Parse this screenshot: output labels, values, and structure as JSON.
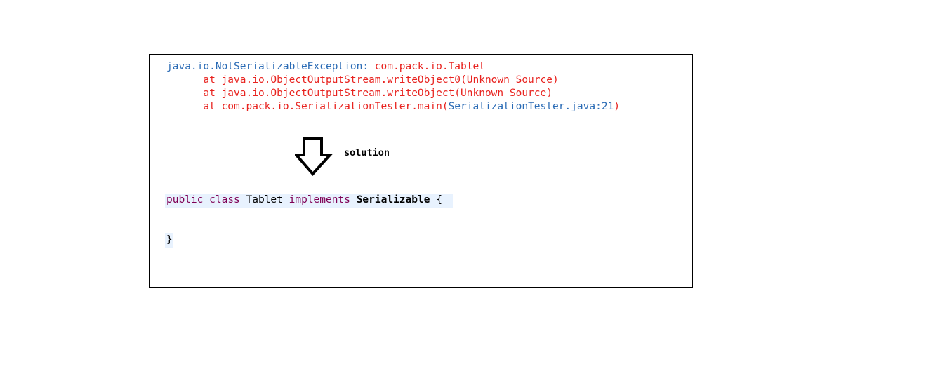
{
  "exception": {
    "class_name": "java.io.NotSerializableException",
    "colon": ":",
    "message": " com.pack.io.Tablet"
  },
  "stack_trace": [
    {
      "text": "      at java.io.ObjectOutputStream.writeObject0(Unknown Source)"
    },
    {
      "text": "      at java.io.ObjectOutputStream.writeObject(Unknown Source)"
    },
    {
      "prefix": "      at com.pack.io.SerializationTester.main(",
      "link": "SerializationTester.java:21",
      "suffix": ")"
    }
  ],
  "arrow": {
    "icon": "down-arrow-icon"
  },
  "solution_label": "solution",
  "code": {
    "kw_public": "public",
    "kw_class": "class",
    "class_name": "Tablet",
    "kw_implements": "implements",
    "interface": "Serializable",
    "open_brace": "{",
    "close_brace": "}"
  },
  "colors": {
    "link_blue": "#2a6bb5",
    "error_red": "#e8231f",
    "keyword_purple": "#7f0055",
    "line_highlight": "#e8f2fe"
  }
}
